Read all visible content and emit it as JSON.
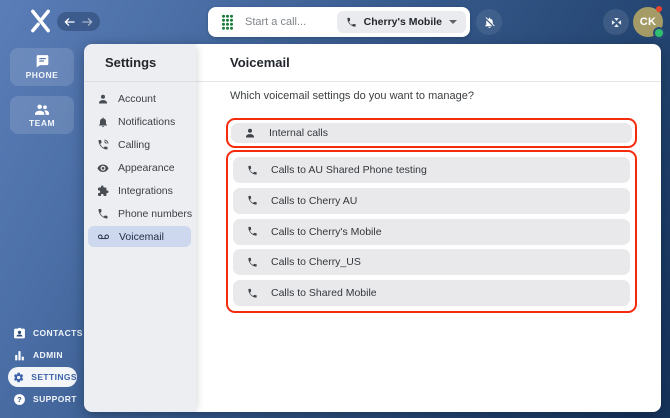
{
  "topbar": {
    "back_label": "back",
    "forward_label": "forward",
    "start_call_placeholder": "Start a call...",
    "caller_id": {
      "label": "Cherry's Mobile",
      "icon": "phone-icon",
      "caret": "chevron-down-icon"
    },
    "notifications_icon": "bell-off-icon",
    "collapse_icon": "collapse-icon",
    "dialpad_icon": "dialpad-icon",
    "avatar": {
      "initials": "CK",
      "status": "online"
    }
  },
  "sidebar": {
    "primary": [
      {
        "label": "PHONE",
        "icon": "chat-bubble-icon"
      },
      {
        "label": "TEAM",
        "icon": "people-icon"
      }
    ],
    "secondary": [
      {
        "label": "CONTACTS",
        "icon": "contact-card-icon",
        "active": false
      },
      {
        "label": "ADMIN",
        "icon": "bar-chart-icon",
        "active": false
      },
      {
        "label": "SETTINGS",
        "icon": "gear-icon",
        "active": true
      },
      {
        "label": "SUPPORT",
        "icon": "help-icon",
        "active": false
      }
    ]
  },
  "settings_panel": {
    "title": "Settings",
    "items": [
      {
        "label": "Account",
        "icon": "person-icon",
        "active": false
      },
      {
        "label": "Notifications",
        "icon": "bell-icon",
        "active": false
      },
      {
        "label": "Calling",
        "icon": "phone-in-talk-icon",
        "active": false
      },
      {
        "label": "Appearance",
        "icon": "eye-icon",
        "active": false
      },
      {
        "label": "Integrations",
        "icon": "puzzle-icon",
        "active": false
      },
      {
        "label": "Phone numbers",
        "icon": "phone-icon",
        "active": false
      },
      {
        "label": "Voicemail",
        "icon": "voicemail-icon",
        "active": true
      }
    ]
  },
  "main": {
    "title": "Voicemail",
    "question": "Which voicemail settings do you want to manage?",
    "internal_option": {
      "label": "Internal calls",
      "icon": "person-icon"
    },
    "call_options": [
      {
        "label": "Calls to AU Shared Phone testing",
        "icon": "phone-icon"
      },
      {
        "label": "Calls to Cherry AU",
        "icon": "phone-icon"
      },
      {
        "label": "Calls to Cherry's Mobile",
        "icon": "phone-icon"
      },
      {
        "label": "Calls to Cherry_US",
        "icon": "phone-icon"
      },
      {
        "label": "Calls to Shared Mobile",
        "icon": "phone-icon"
      }
    ]
  },
  "colors": {
    "annotation_red": "#f42b0c",
    "accent_blue": "#3c62a9",
    "dialpad_green": "#1b7d3c",
    "online_green": "#2fbf71",
    "avatar_bg": "#a49b66",
    "topbar_gradient_start": "#5b7db8",
    "topbar_gradient_end": "#16335b",
    "panel_bg": "#edeef2",
    "menu_highlight": "#cdd8ee",
    "button_bg": "#e9e9eb"
  }
}
